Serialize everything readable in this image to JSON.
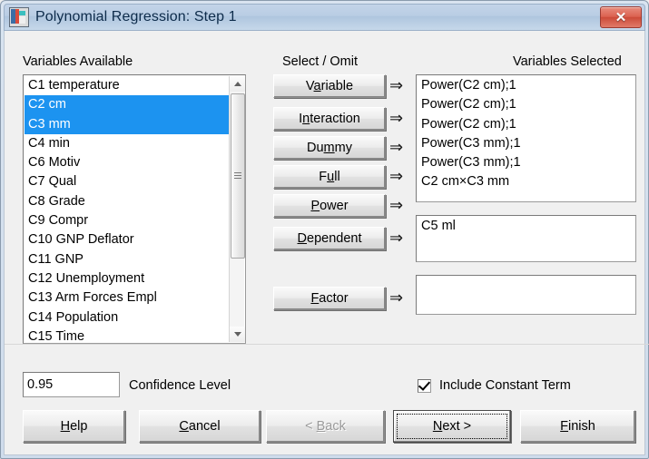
{
  "window": {
    "title": "Polynomial Regression: Step 1",
    "icon": "minitab-worksheet-icon",
    "close_label": "✕"
  },
  "labels": {
    "variables_available": "Variables Available",
    "select_omit": "Select / Omit",
    "variables_selected": "Variables Selected",
    "confidence_level": "Confidence Level"
  },
  "available_list": {
    "items": [
      {
        "text": "C1 temperature",
        "selected": false
      },
      {
        "text": "C2 cm",
        "selected": true
      },
      {
        "text": "C3 mm",
        "selected": true
      },
      {
        "text": "C4 min",
        "selected": false
      },
      {
        "text": "C6 Motiv",
        "selected": false
      },
      {
        "text": "C7 Qual",
        "selected": false
      },
      {
        "text": "C8 Grade",
        "selected": false
      },
      {
        "text": "C9 Compr",
        "selected": false
      },
      {
        "text": "C10 GNP Deflator",
        "selected": false
      },
      {
        "text": "C11 GNP",
        "selected": false
      },
      {
        "text": "C12 Unemployment",
        "selected": false
      },
      {
        "text": "C13 Arm Forces Empl",
        "selected": false
      },
      {
        "text": "C14 Population",
        "selected": false
      },
      {
        "text": "C15 Time",
        "selected": false
      }
    ]
  },
  "selected_list": {
    "items": [
      "Power(C2 cm);1",
      "Power(C2 cm);1",
      "Power(C2 cm);1",
      "Power(C3 mm);1",
      "Power(C3 mm);1",
      "C2 cm×C3 mm"
    ]
  },
  "dependent": {
    "value": "C5 ml"
  },
  "factor": {
    "value": ""
  },
  "action_buttons": [
    {
      "name": "variable",
      "pre": "V",
      "key": "a",
      "post": "riable"
    },
    {
      "name": "interaction",
      "pre": "I",
      "key": "n",
      "post": "teraction"
    },
    {
      "name": "dummy",
      "pre": "Du",
      "key": "m",
      "post": "my"
    },
    {
      "name": "full",
      "pre": "F",
      "key": "u",
      "post": "ll"
    },
    {
      "name": "power",
      "pre": "",
      "key": "P",
      "post": "ower"
    }
  ],
  "assign_buttons": [
    {
      "name": "dependent",
      "pre": "",
      "key": "D",
      "post": "ependent"
    },
    {
      "name": "factor",
      "pre": "",
      "key": "F",
      "post": "actor"
    }
  ],
  "arrow_glyph": "⇒",
  "confidence": {
    "value": "0.95"
  },
  "include_constant": {
    "label": "Include Constant Term",
    "checked": true
  },
  "footer_buttons": [
    {
      "name": "help",
      "pre": "",
      "key": "H",
      "post": "elp",
      "disabled": false,
      "focus": false
    },
    {
      "name": "cancel",
      "pre": "",
      "key": "C",
      "post": "ancel",
      "disabled": false,
      "focus": false
    },
    {
      "name": "back",
      "pre": "< ",
      "key": "B",
      "post": "ack",
      "disabled": true,
      "focus": false
    },
    {
      "name": "next",
      "pre": "",
      "key": "N",
      "post": "ext >",
      "disabled": false,
      "focus": true
    },
    {
      "name": "finish",
      "pre": "",
      "key": "F",
      "post": "inish",
      "disabled": false,
      "focus": false
    }
  ],
  "colors": {
    "selection": "#1c93f0",
    "dialog_bg": "#f0f0f0",
    "title_bg": "#b9cde4",
    "close_red": "#cc4a38"
  }
}
